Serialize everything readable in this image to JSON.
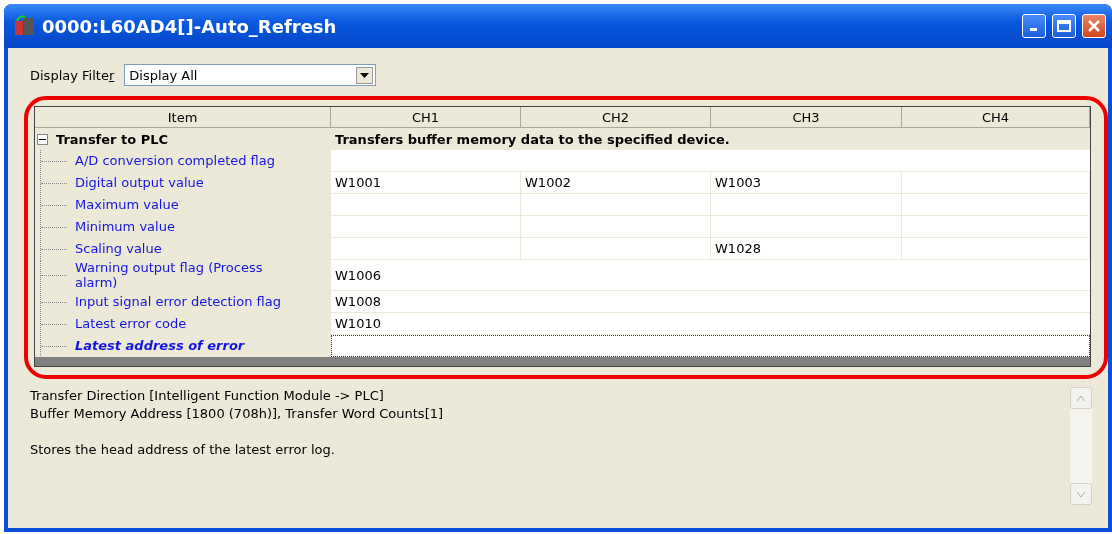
{
  "window": {
    "title": "0000:L60AD4[]-Auto_Refresh"
  },
  "display_filter": {
    "label": "Display Filter",
    "value": "Display All"
  },
  "table": {
    "columns": [
      "Item",
      "CH1",
      "CH2",
      "CH3",
      "CH4"
    ],
    "groups": [
      {
        "label": "Transfer to PLC",
        "expanded": true,
        "description": "Transfers buffer memory data to the specified device.",
        "children": [
          {
            "label": "A/D conversion completed flag",
            "kind": "merged",
            "selected": false
          },
          {
            "label": "Digital output value",
            "kind": "per_channel",
            "selected": false,
            "cells": [
              "W1001",
              "W1002",
              "W1003",
              null
            ]
          },
          {
            "label": "Maximum value",
            "kind": "per_channel",
            "selected": false,
            "cells": [
              null,
              null,
              null,
              null
            ]
          },
          {
            "label": "Minimum value",
            "kind": "per_channel",
            "selected": false,
            "cells": [
              null,
              null,
              null,
              null
            ]
          },
          {
            "label": "Scaling value",
            "kind": "per_channel",
            "selected": false,
            "cells": [
              null,
              null,
              "W1028",
              null
            ]
          },
          {
            "label": "Warning output flag (Process alarm)",
            "kind": "merged",
            "selected": false,
            "value": "W1006"
          },
          {
            "label": "Input signal error detection flag",
            "kind": "merged",
            "selected": false,
            "value": "W1008"
          },
          {
            "label": "Latest error code",
            "kind": "merged",
            "selected": false,
            "value": "W1010"
          },
          {
            "label": "Latest address of error",
            "kind": "merged",
            "selected": true
          }
        ]
      }
    ]
  },
  "description": {
    "paragraphs": [
      [
        "Transfer Direction [Intelligent Function Module -> PLC]",
        "Buffer Memory Address [1800 (708h)], Transfer Word Counts[1]"
      ],
      [
        "Stores the head address of the latest error log."
      ]
    ]
  }
}
